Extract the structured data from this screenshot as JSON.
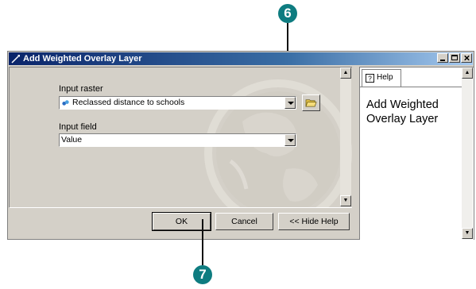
{
  "window": {
    "title": "Add Weighted Overlay Layer",
    "controls": [
      "minimize",
      "maximize",
      "close"
    ]
  },
  "callouts": {
    "top": "6",
    "bottom": "7"
  },
  "form": {
    "input_raster_label": "Input raster",
    "input_raster_value": "Reclassed distance to schools",
    "input_field_label": "Input field",
    "input_field_value": "Value"
  },
  "buttons": {
    "ok": "OK",
    "cancel": "Cancel",
    "hide_help": "<< Hide Help"
  },
  "help": {
    "tab_label": "Help",
    "title": "Add Weighted Overlay Layer"
  },
  "colors": {
    "callout": "#0e7c80",
    "titlebar_start": "#0a246a",
    "titlebar_end": "#a6caf0"
  }
}
